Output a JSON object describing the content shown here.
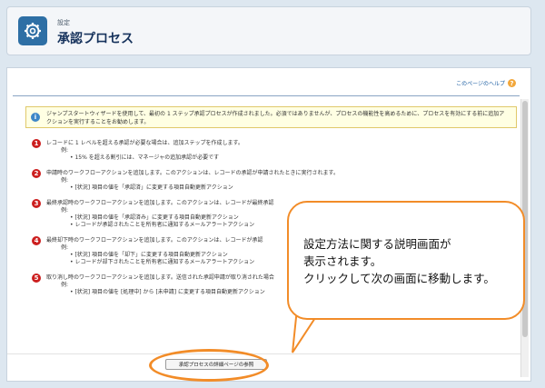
{
  "header": {
    "eyebrow": "設定",
    "title": "承認プロセス",
    "icon": "gear-icon"
  },
  "help": {
    "label": "このページのヘルプ",
    "icon": "help-icon"
  },
  "info": {
    "icon": "info-icon",
    "text": "ジャンプスタートウィザードを使用して、最初の 1 ステップ承認プロセスが作成されました。必須ではありませんが、プロセスの機能性を高めるために、プロセスを有効にする前に追加アクションを実行することをお勧めします。"
  },
  "steps": [
    {
      "num": "1",
      "text": "レコードに 1 レベルを超える承認が必要な場合は、追加ステップを作成します。",
      "example_label": "例:",
      "examples": [
        "15% を超える割引には、マネージャの追加承認が必要です"
      ]
    },
    {
      "num": "2",
      "text": "申請時のワークフローアクションを追加します。このアクションは、レコードの承認が申請されたときに実行されます。",
      "example_label": "例:",
      "examples": [
        "[状況] 項目の値を「承認済」に変更する項目自動更新アクション"
      ]
    },
    {
      "num": "3",
      "text": "最終承認時のワークフローアクションを追加します。このアクションは、レコードが最終承認",
      "example_label": "例:",
      "examples": [
        "[状況] 項目の値を「承認済み」に変更する項目自動更新アクション",
        "レコードが承認されたことを所有者に通知するメールアラートアクション"
      ]
    },
    {
      "num": "4",
      "text": "最終却下時のワークフローアクションを追加します。このアクションは、レコードが承認",
      "example_label": "例:",
      "examples": [
        "[状況] 項目の値を「却下」に変更する項目自動更新アクション",
        "レコードが却下されたことを所有者に通知するメールアラートアクション"
      ]
    },
    {
      "num": "5",
      "text": "取り消し時のワークフローアクションを追加します。送信された承認申請が取り消された場合",
      "example_label": "例:",
      "examples": [
        "[状況] 項目の値を [処理中] から [未申請] に変更する項目自動更新アクション"
      ]
    }
  ],
  "footer": {
    "button_label": "承認プロセスの詳細ページの参照"
  },
  "callout": {
    "lines": [
      "設定方法に関する説明画面が",
      "表示されます。",
      "クリックして次の画面に移動します。"
    ]
  },
  "colors": {
    "header_icon": "#2e6fa5",
    "step_number": "#cc1f1f",
    "highlight": "#f28c28",
    "info_box": "#ffffe3"
  }
}
